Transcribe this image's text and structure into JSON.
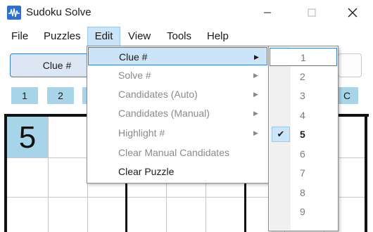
{
  "window": {
    "title": "Sudoku Solve",
    "icon": "sudoku-waveform-icon",
    "controls": [
      "minimize-icon",
      "maximize-icon",
      "close-icon"
    ]
  },
  "menubar": {
    "items": [
      "File",
      "Puzzles",
      "Edit",
      "View",
      "Tools",
      "Help"
    ],
    "open": "Edit"
  },
  "toolbar": {
    "mode_label": "Clue #",
    "digit_buttons": [
      "1",
      "2"
    ],
    "right_partial_label": "C"
  },
  "grid": {
    "given_cells": [
      {
        "row": 1,
        "col": 1,
        "value": "5"
      }
    ]
  },
  "edit_menu": {
    "items": [
      {
        "label": "Clue #",
        "has_submenu": true,
        "state": "active"
      },
      {
        "label": "Solve #",
        "has_submenu": true,
        "state": "disabled"
      },
      {
        "label": "Candidates (Auto)",
        "has_submenu": true,
        "state": "disabled"
      },
      {
        "label": "Candidates (Manual)",
        "has_submenu": true,
        "state": "disabled"
      },
      {
        "label": "Highlight #",
        "has_submenu": true,
        "state": "disabled"
      },
      {
        "label": "Clear Manual Candidates",
        "has_submenu": false,
        "state": "disabled"
      },
      {
        "label": "Clear Puzzle",
        "has_submenu": false,
        "state": "enabled"
      }
    ]
  },
  "clue_submenu": {
    "items": [
      "1",
      "2",
      "3",
      "4",
      "5",
      "6",
      "7",
      "8",
      "9"
    ],
    "checked": "5",
    "highlighted": "1",
    "check_mark": "✔"
  },
  "colors": {
    "accent": "#3c7fc9",
    "menu_highlight": "#cce4f7",
    "cell_given": "#a7d4e8",
    "disabled_text": "#8a8a8a"
  }
}
